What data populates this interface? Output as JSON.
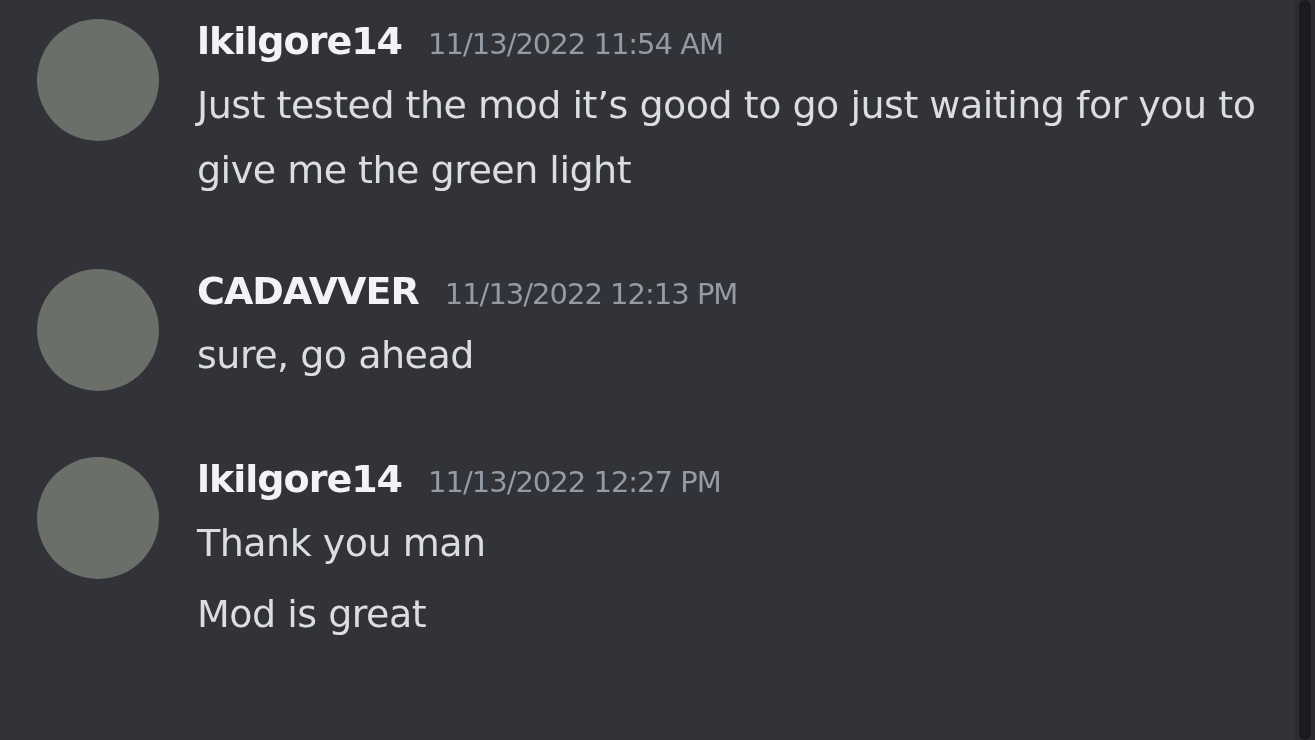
{
  "messages": [
    {
      "author": "lkilgore14",
      "timestamp": "11/13/2022 11:54 AM",
      "lines": [
        "Just tested the mod it’s good to go just waiting for you to give me the green light"
      ]
    },
    {
      "author": "CADAVVER",
      "timestamp": "11/13/2022 12:13 PM",
      "lines": [
        "sure, go ahead"
      ]
    },
    {
      "author": "lkilgore14",
      "timestamp": "11/13/2022 12:27 PM",
      "lines": [
        "Thank you man",
        "Mod is great"
      ]
    }
  ]
}
